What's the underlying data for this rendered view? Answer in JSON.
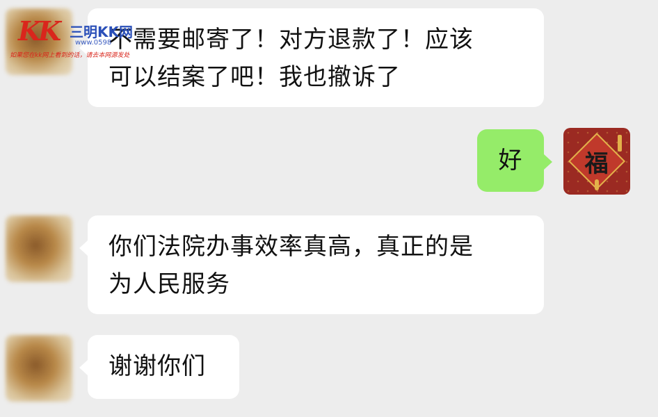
{
  "watermark": {
    "logo": "KK",
    "name": "三明KK网",
    "url": "www.0598",
    "slogan": "如果您在kk网上看到的话，请去本网源发处"
  },
  "messages": [
    {
      "side": "incoming",
      "avatar": "blurred-avatar",
      "text_lines": [
        "不需要邮寄了！对方退款了！应该",
        "可以结案了吧！我也撤诉了"
      ]
    },
    {
      "side": "outgoing",
      "avatar": "fu-avatar",
      "avatar_char": "福",
      "text_lines": [
        "好"
      ]
    },
    {
      "side": "incoming",
      "avatar": "blurred-avatar",
      "text_lines": [
        "你们法院办事效率真高，真正的是",
        "为人民服务"
      ]
    },
    {
      "side": "incoming",
      "avatar": "blurred-avatar",
      "text_lines": [
        "谢谢你们"
      ]
    }
  ],
  "colors": {
    "background": "#ededed",
    "incoming_bubble": "#ffffff",
    "outgoing_bubble": "#95ec69"
  }
}
